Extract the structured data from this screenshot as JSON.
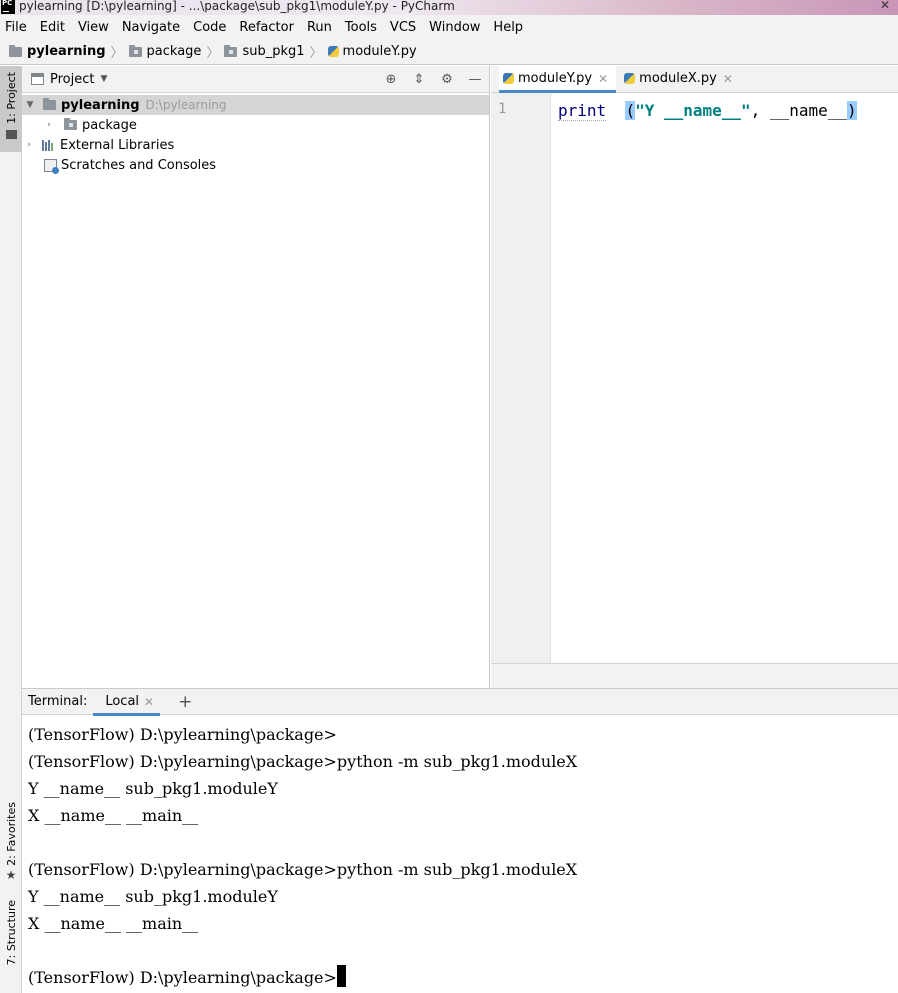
{
  "window": {
    "title": "pylearning [D:\\pylearning] - ...\\package\\sub_pkg1\\moduleY.py - PyCharm",
    "app_icon": "PC"
  },
  "menu": [
    {
      "label": "File"
    },
    {
      "label": "Edit"
    },
    {
      "label": "View"
    },
    {
      "label": "Navigate"
    },
    {
      "label": "Code"
    },
    {
      "label": "Refactor"
    },
    {
      "label": "Run"
    },
    {
      "label": "Tools"
    },
    {
      "label": "VCS"
    },
    {
      "label": "Window"
    },
    {
      "label": "Help"
    }
  ],
  "breadcrumbs": [
    "pylearning",
    "package",
    "sub_pkg1",
    "moduleY.py"
  ],
  "side_tabs": {
    "project": "1: Project",
    "favorites": "2: Favorites",
    "structure": "7: Structure"
  },
  "project_panel": {
    "title": "Project",
    "tree": [
      {
        "label": "pylearning",
        "hint": "D:\\pylearning"
      },
      {
        "label": "package"
      },
      {
        "label": "External Libraries"
      },
      {
        "label": "Scratches and Consoles"
      }
    ]
  },
  "editor": {
    "tabs": [
      {
        "label": "moduleY.py",
        "active": true
      },
      {
        "label": "moduleX.py",
        "active": false
      }
    ],
    "line_number": "1",
    "code": {
      "fn": "print",
      "open_paren": "(",
      "string": "\"Y __name__\"",
      "rest": ", __name__",
      "close_paren": ")"
    }
  },
  "terminal": {
    "label": "Terminal:",
    "tab": "Local",
    "lines": [
      "(TensorFlow) D:\\pylearning\\package>",
      "(TensorFlow) D:\\pylearning\\package>python -m sub_pkg1.moduleX",
      "Y __name__ sub_pkg1.moduleY",
      "X __name__ __main__",
      "",
      "(TensorFlow) D:\\pylearning\\package>python -m sub_pkg1.moduleX",
      "Y __name__ sub_pkg1.moduleY",
      "X __name__ __main__",
      "",
      "(TensorFlow) D:\\pylearning\\package>"
    ]
  }
}
